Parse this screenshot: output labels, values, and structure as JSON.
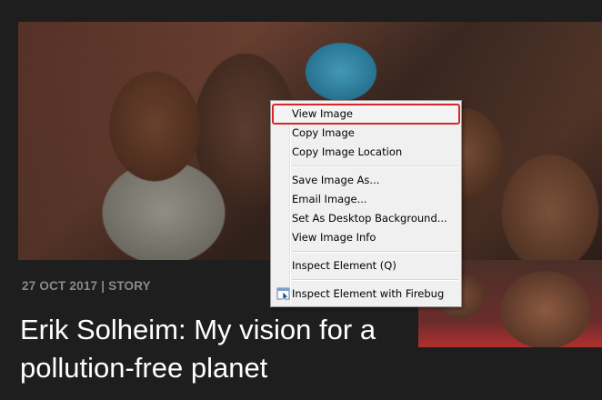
{
  "article": {
    "meta": "27 OCT 2017 | STORY",
    "headline": "Erik Solheim: My vision for a pollution-free planet"
  },
  "context_menu": {
    "items": [
      {
        "label": "View Image",
        "highlighted": true
      },
      {
        "label": "Copy Image"
      },
      {
        "label": "Copy Image Location"
      },
      {
        "label": "Save Image As..."
      },
      {
        "label": "Email Image..."
      },
      {
        "label": "Set As Desktop Background..."
      },
      {
        "label": "View Image Info"
      },
      {
        "label": "Inspect Element (Q)"
      },
      {
        "label": "Inspect Element with Firebug",
        "icon": "firebug-icon"
      }
    ]
  },
  "colors": {
    "page_background": "#1e1e1e",
    "highlight_outline": "#d8262f",
    "menu_background": "#f0f0f0",
    "meta_text": "#8a8a8a",
    "headline_text": "#ffffff"
  }
}
